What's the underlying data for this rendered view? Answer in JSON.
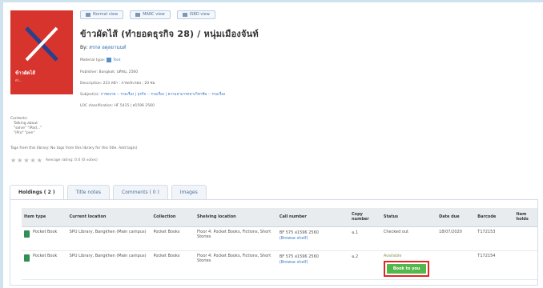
{
  "view_tabs": [
    "Normal view",
    "MARC view",
    "ISBD view"
  ],
  "cover": {
    "title": "ข้าวผัดไส้",
    "subtitle": "ทำ..."
  },
  "record": {
    "title": "ข้าวผัดไส้ (ทำยอดธุรกิจ 28) / หนุ่มเมืองจันท์",
    "by_label": "By:",
    "author": "สรกล อดุลยานนท์",
    "material_type": "Material type:",
    "material_value": "Text",
    "publisher": "Publisher: Bangkok: มติชน, 2560",
    "description": "Description: 223 หน้า : ภาพประกอบ ; 20 ซม",
    "subjects_label": "Subject(s):",
    "subjects": "การตลาด -- รวมเรื่อง | ธุรกิจ -- รวมเรื่อง | ความสามารถทางวิชาชีพ -- รวมเรื่อง",
    "loc": "LOC classification: HF 5415 | ส1596 2560"
  },
  "contents": {
    "label": "Contents:",
    "lines": [
      "Talking about",
      "\"solve\" \"iPad...\"",
      "\"iPro\" \"pen\""
    ]
  },
  "tags_line": "Tags from this library: No tags from this library for this title. Add tag(s)",
  "rating": {
    "stars": "★★★★★",
    "text": "Average rating: 0.0 (0 votes)"
  },
  "tabs": [
    "Holdings ( 2 )",
    "Title notes",
    "Comments ( 0 )",
    "Images"
  ],
  "table": {
    "headers": [
      "Item type",
      "Current location",
      "Collection",
      "Shelving location",
      "Call number",
      "Copy number",
      "Status",
      "Date due",
      "Barcode",
      "Item holds"
    ],
    "rows": [
      {
        "item_type": "Pocket Book",
        "location": "SPU Library, Bangkhen (Main campus)",
        "collection": "Pocket Books",
        "shelving": "Floor 4: Pocket Books, Fictions, Short Stories",
        "call_number": "BF 575 ส1596 2560",
        "browse": "(Browse shelf)",
        "copy": "ฉ.1",
        "status": "Checked out",
        "date_due": "18/07/2020",
        "barcode": "T172153",
        "holds": ""
      },
      {
        "item_type": "Pocket Book",
        "location": "SPU Library, Bangkhen (Main campus)",
        "collection": "Pocket Books",
        "shelving": "Floor 4: Pocket Books, Fictions, Short Stories",
        "call_number": "BF 575 ส1596 2560",
        "browse": "(Browse shelf)",
        "copy": "ฉ.2",
        "status": "Available",
        "hold_button": "Book to you",
        "date_due": "",
        "barcode": "T172154",
        "holds": ""
      }
    ]
  },
  "colors": {
    "cover": "#d7342d",
    "hold_button": "#52b84b",
    "highlight": "#e32526",
    "link": "#3d7cc4"
  }
}
